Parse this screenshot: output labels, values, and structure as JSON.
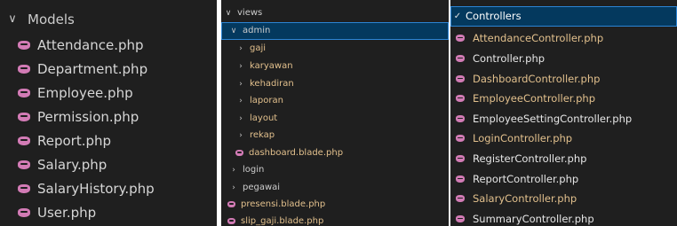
{
  "models_panel": {
    "folder": "Models",
    "files": [
      "Attendance.php",
      "Department.php",
      "Employee.php",
      "Permission.php",
      "Report.php",
      "Salary.php",
      "SalaryHistory.php",
      "User.php"
    ]
  },
  "views_panel": {
    "views": "views",
    "admin": "admin",
    "admin_children": [
      "gaji",
      "karyawan",
      "kehadiran",
      "laporan",
      "layout",
      "rekap"
    ],
    "admin_file": "dashboard.blade.php",
    "siblings": [
      "login",
      "pegawai"
    ],
    "files": [
      "presensi.blade.php",
      "slip_gaji.blade.php"
    ]
  },
  "controllers_panel": {
    "folder": "Controllers",
    "files": [
      "AttendanceController.php",
      "Controller.php",
      "DashboardController.php",
      "EmployeeController.php",
      "EmployeeSettingController.php",
      "LoginController.php",
      "RegisterController.php",
      "ReportController.php",
      "SalaryController.php",
      "SummaryController.php"
    ]
  },
  "colors": {
    "background": "#1f1f1f",
    "php_icon": "#d27bb5",
    "modified_text": "#e2c08d",
    "selection": "#04395e"
  }
}
